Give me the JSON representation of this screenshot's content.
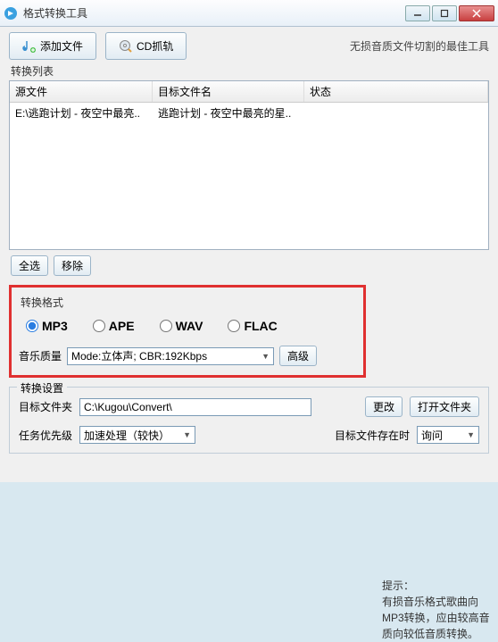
{
  "window": {
    "title": "格式转换工具",
    "tagline": "无损音质文件切割的最佳工具"
  },
  "toolbar": {
    "add_file": "添加文件",
    "cd_grab": "CD抓轨"
  },
  "list": {
    "label": "转换列表",
    "col_source": "源文件",
    "col_target": "目标文件名",
    "col_status": "状态",
    "rows": [
      {
        "source": "E:\\逃跑计划 - 夜空中最亮..",
        "target": "逃跑计划 - 夜空中最亮的星..",
        "status": ""
      }
    ],
    "select_all": "全选",
    "remove": "移除"
  },
  "format": {
    "label": "转换格式",
    "opt_mp3": "MP3",
    "opt_ape": "APE",
    "opt_wav": "WAV",
    "opt_flac": "FLAC",
    "quality_label": "音乐质量",
    "quality_value": "Mode:立体声; CBR:192Kbps",
    "advanced": "高级"
  },
  "tip": {
    "label": "提示：",
    "body": "有损音乐格式歌曲向MP3转换，应由较高音质向较低音质转换。"
  },
  "settings": {
    "legend": "转换设置",
    "dest_label": "目标文件夹",
    "dest_value": "C:\\Kugou\\Convert\\",
    "change": "更改",
    "open": "打开文件夹",
    "priority_label": "任务优先级",
    "priority_value": "加速处理（较快）",
    "exists_label": "目标文件存在时",
    "exists_value": "询问"
  }
}
